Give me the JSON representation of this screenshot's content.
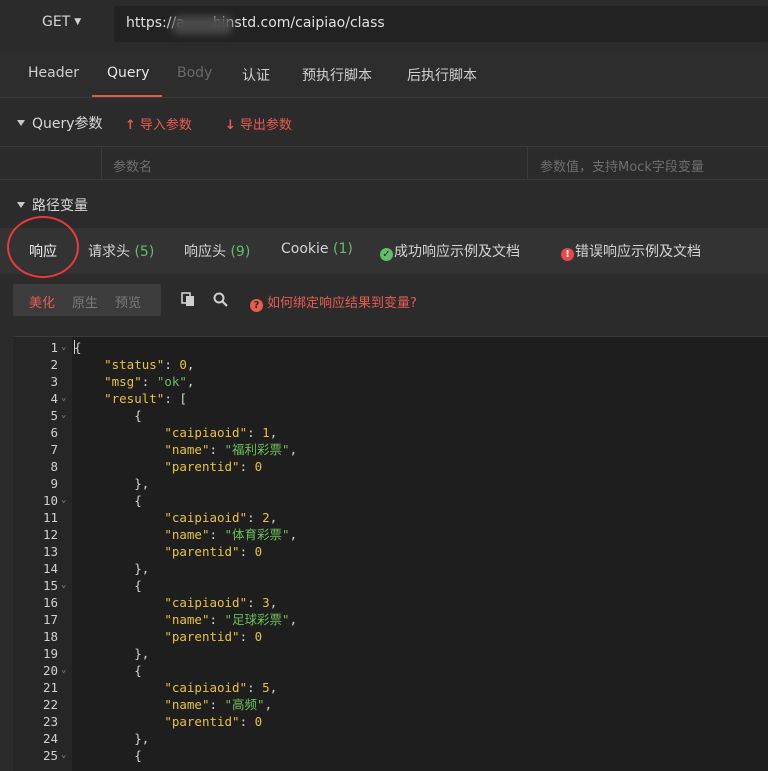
{
  "request": {
    "method": "GET",
    "url": "https://a  binstd.com/caipiao/class"
  },
  "request_tabs": [
    "Header",
    "Query",
    "Body",
    "认证",
    "预执行脚本",
    "后执行脚本"
  ],
  "query": {
    "title": "Query参数",
    "import_label": "导入参数",
    "export_label": "导出参数",
    "name_placeholder": "参数名",
    "value_placeholder": "参数值，支持Mock字段变量"
  },
  "path_vars": {
    "title": "路径变量"
  },
  "response_tabs": {
    "response": "响应",
    "req_headers": "请求头",
    "req_headers_count": "(5)",
    "resp_headers": "响应头",
    "resp_headers_count": "(9)",
    "cookie": "Cookie",
    "cookie_count": "(1)",
    "success_example": "成功响应示例及文档",
    "error_example": "错误响应示例及文档"
  },
  "view_modes": [
    "美化",
    "原生",
    "预览"
  ],
  "help_text": "如何绑定响应结果到变量?",
  "colors": {
    "accent": "#e85d4e",
    "count_green": "#5fbf6a",
    "json_key": "#e8c23c",
    "json_string": "#6cbf5a"
  },
  "code_lines": [
    {
      "n": "1",
      "fold": true,
      "html": "<span class='p'>{</span>"
    },
    {
      "n": "2",
      "fold": false,
      "html": "    <span class='k'>\"status\"</span><span class='p'>: </span><span class='n'>0</span><span class='p'>,</span>"
    },
    {
      "n": "3",
      "fold": false,
      "html": "    <span class='k'>\"msg\"</span><span class='p'>: </span><span class='s'>\"ok\"</span><span class='p'>,</span>"
    },
    {
      "n": "4",
      "fold": true,
      "html": "    <span class='k'>\"result\"</span><span class='p'>: [</span>"
    },
    {
      "n": "5",
      "fold": true,
      "html": "        <span class='p'>{</span>"
    },
    {
      "n": "6",
      "fold": false,
      "html": "            <span class='k'>\"caipiaoid\"</span><span class='p'>: </span><span class='n'>1</span><span class='p'>,</span>"
    },
    {
      "n": "7",
      "fold": false,
      "html": "            <span class='k'>\"name\"</span><span class='p'>: </span><span class='s'>\"福利彩票\"</span><span class='p'>,</span>"
    },
    {
      "n": "8",
      "fold": false,
      "html": "            <span class='k'>\"parentid\"</span><span class='p'>: </span><span class='n'>0</span>"
    },
    {
      "n": "9",
      "fold": false,
      "html": "        <span class='p'>},</span>"
    },
    {
      "n": "10",
      "fold": true,
      "html": "        <span class='p'>{</span>"
    },
    {
      "n": "11",
      "fold": false,
      "html": "            <span class='k'>\"caipiaoid\"</span><span class='p'>: </span><span class='n'>2</span><span class='p'>,</span>"
    },
    {
      "n": "12",
      "fold": false,
      "html": "            <span class='k'>\"name\"</span><span class='p'>: </span><span class='s'>\"体育彩票\"</span><span class='p'>,</span>"
    },
    {
      "n": "13",
      "fold": false,
      "html": "            <span class='k'>\"parentid\"</span><span class='p'>: </span><span class='n'>0</span>"
    },
    {
      "n": "14",
      "fold": false,
      "html": "        <span class='p'>},</span>"
    },
    {
      "n": "15",
      "fold": true,
      "html": "        <span class='p'>{</span>"
    },
    {
      "n": "16",
      "fold": false,
      "html": "            <span class='k'>\"caipiaoid\"</span><span class='p'>: </span><span class='n'>3</span><span class='p'>,</span>"
    },
    {
      "n": "17",
      "fold": false,
      "html": "            <span class='k'>\"name\"</span><span class='p'>: </span><span class='s'>\"足球彩票\"</span><span class='p'>,</span>"
    },
    {
      "n": "18",
      "fold": false,
      "html": "            <span class='k'>\"parentid\"</span><span class='p'>: </span><span class='n'>0</span>"
    },
    {
      "n": "19",
      "fold": false,
      "html": "        <span class='p'>},</span>"
    },
    {
      "n": "20",
      "fold": true,
      "html": "        <span class='p'>{</span>"
    },
    {
      "n": "21",
      "fold": false,
      "html": "            <span class='k'>\"caipiaoid\"</span><span class='p'>: </span><span class='n'>5</span><span class='p'>,</span>"
    },
    {
      "n": "22",
      "fold": false,
      "html": "            <span class='k'>\"name\"</span><span class='p'>: </span><span class='s'>\"高频\"</span><span class='p'>,</span>"
    },
    {
      "n": "23",
      "fold": false,
      "html": "            <span class='k'>\"parentid\"</span><span class='p'>: </span><span class='n'>0</span>"
    },
    {
      "n": "24",
      "fold": false,
      "html": "        <span class='p'>},</span>"
    },
    {
      "n": "25",
      "fold": true,
      "html": "        <span class='p'>{</span>"
    }
  ]
}
